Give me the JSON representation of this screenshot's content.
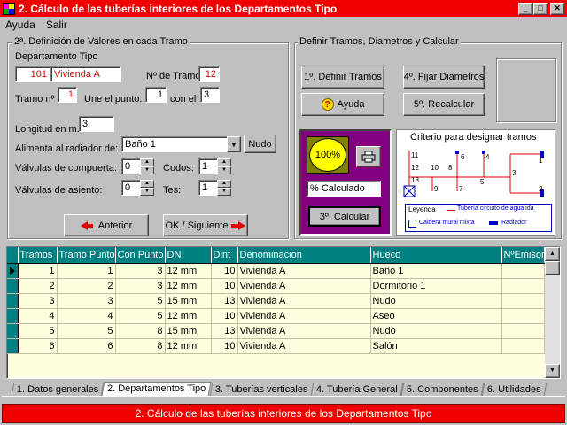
{
  "window": {
    "title": "2. Cálculo de las tuberías interiores de los Departamentos Tipo",
    "minimize_glyph": "_",
    "maximize_glyph": "□",
    "close_glyph": "✕"
  },
  "menu": [
    "Ayuda",
    "Salir"
  ],
  "left_group": {
    "label": "2ª. Definición de Valores en cada Tramo",
    "departamento_label": "Departamento Tipo",
    "departamento_num": "101",
    "departamento_name": "Vivienda A",
    "num_tramos_label": "Nº de Tramos:",
    "num_tramos": "12",
    "tramo_label": "Tramo nº",
    "tramo_value": "1",
    "une_label": "Une el punto:",
    "une_value": "1",
    "con_label": "con el",
    "con_value": "3",
    "longitud_label": "Longitud en m.",
    "longitud_value": "3",
    "alimenta_label": "Alimenta al radiador de:",
    "alimenta_value": "Baño 1",
    "nudo_button": "Nudo",
    "compuerta_label": "Válvulas de compuerta:",
    "compuerta_value": "0",
    "codos_label": "Codos:",
    "codos_value": "1",
    "asiento_label": "Válvulas de asiento:",
    "asiento_value": "0",
    "tes_label": "Tes:",
    "tes_value": "1",
    "anterior_button": "Anterior",
    "siguiente_button": "OK / Siguiente"
  },
  "right_group": {
    "label": "Definir Tramos, Diametros y Calcular",
    "definir_button": "1º. Definir Tramos",
    "fijar_button": "4º. Fijar Diametros",
    "ayuda_button": "Ayuda",
    "recalcular_button": "5º. Recalcular",
    "progress_text": "100%",
    "calculado_text": "% Calculado",
    "calcular_button": "3º. Calcular"
  },
  "criterio": {
    "title": "Criterio para designar tramos",
    "node_labels": [
      "11",
      "12",
      "13",
      "9",
      "10",
      "7",
      "8",
      "6",
      "5",
      "4",
      "3",
      "1",
      "2"
    ],
    "legend_title": "Leyenda",
    "legend_line": "Tubería circuito de agua ida",
    "legend_boiler": "Caldera mural mixta",
    "legend_radiator": "Radiador"
  },
  "colors": {
    "title_bg": "#f00000",
    "grid_header": "#008080",
    "grid_cell": "#ffffe0",
    "purple_panel": "#800080",
    "progress_yellow": "#ffff00",
    "legend_red": "#e00000",
    "legend_blue": "#0000c0"
  },
  "table": {
    "columns": [
      "Tramos",
      "Tramo Punto",
      "Con Punto",
      "DN",
      "Dint",
      "Denominacion",
      "Hueco",
      "NºEmisor"
    ],
    "rows": [
      [
        "1",
        "1",
        "3",
        "12 mm",
        "10",
        "Vivienda A",
        "Baño 1",
        ""
      ],
      [
        "2",
        "2",
        "3",
        "12 mm",
        "10",
        "Vivienda A",
        "Dormitorio 1",
        ""
      ],
      [
        "3",
        "3",
        "5",
        "15 mm",
        "13",
        "Vivienda A",
        "Nudo",
        ""
      ],
      [
        "4",
        "4",
        "5",
        "12 mm",
        "10",
        "Vivienda A",
        "Aseo",
        ""
      ],
      [
        "5",
        "5",
        "8",
        "15 mm",
        "13",
        "Vivienda A",
        "Nudo",
        ""
      ],
      [
        "6",
        "6",
        "8",
        "12 mm",
        "10",
        "Vivienda A",
        "Salón",
        ""
      ]
    ]
  },
  "tabs": [
    "1. Datos generales",
    "2. Departamentos Tipo",
    "3. Tuberías verticales",
    "4. Tubería General",
    "5. Componentes",
    "6. Utilidades"
  ],
  "active_tab": 1,
  "status_text": "2. Cálculo de las tuberías interiores de los Departamentos Tipo"
}
